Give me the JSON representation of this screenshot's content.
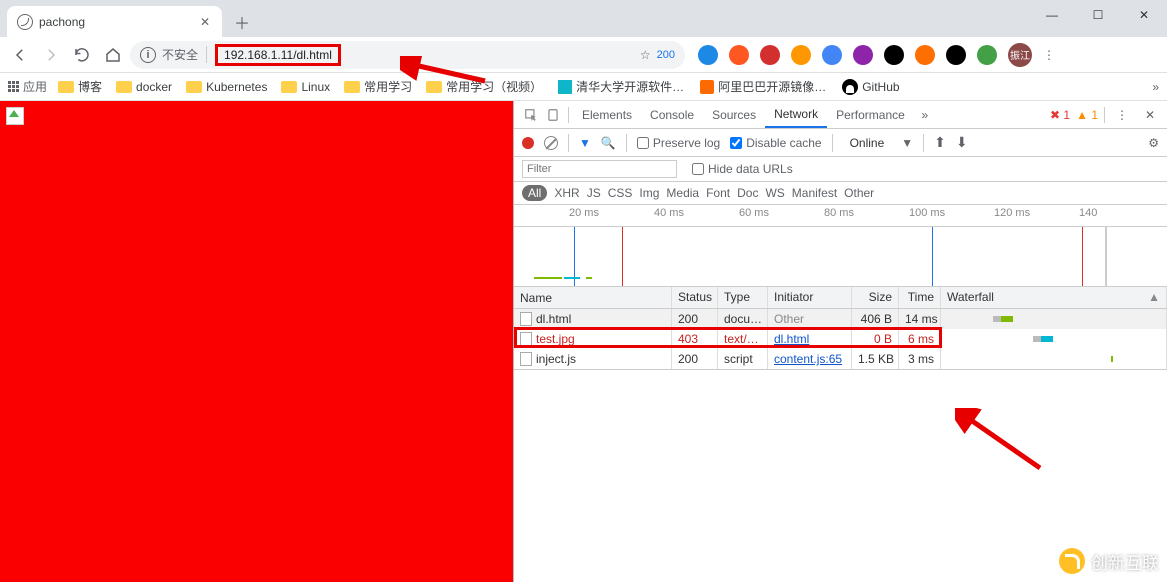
{
  "browser": {
    "tab_title": "pachong",
    "new_tab": "＋",
    "win": {
      "min": "—",
      "max": "☐",
      "close": "✕"
    },
    "address": {
      "security_text": "不安全",
      "url": "192.168.1.11/dl.html",
      "star": "☆",
      "pill": "200"
    },
    "ext_colors": [
      "#1e88e5",
      "#ff5722",
      "#d32f2f",
      "#ff9800",
      "#4285f4",
      "#8e24aa",
      "#000000",
      "#ff6f00",
      "#000000",
      "#43a047"
    ],
    "avatar": "振江",
    "bookmarks": {
      "apps": "应用",
      "items": [
        "博客",
        "docker",
        "Kubernetes",
        "Linux",
        "常用学习",
        "常用学习（视频）"
      ],
      "tsinghua": "清华大学开源软件…",
      "aliyun": "阿里巴巴开源镜像…",
      "github": "GitHub"
    }
  },
  "devtools": {
    "tabs": [
      "Elements",
      "Console",
      "Sources",
      "Network",
      "Performance"
    ],
    "active_tab": "Network",
    "err_count": "1",
    "warn_count": "1",
    "toolbar": {
      "preserve": "Preserve log",
      "disable_cache": "Disable cache",
      "online": "Online"
    },
    "filter_placeholder": "Filter",
    "hide_urls": "Hide data URLs",
    "ftypes": [
      "All",
      "XHR",
      "JS",
      "CSS",
      "Img",
      "Media",
      "Font",
      "Doc",
      "WS",
      "Manifest",
      "Other"
    ],
    "timeline_ticks": [
      "20 ms",
      "40 ms",
      "60 ms",
      "80 ms",
      "100 ms",
      "120 ms",
      "140"
    ],
    "table": {
      "headers": [
        "Name",
        "Status",
        "Type",
        "Initiator",
        "Size",
        "Time",
        "Waterfall"
      ],
      "rows": [
        {
          "name": "dl.html",
          "status": "200",
          "type": "docu…",
          "init": "Other",
          "init_c": "#888",
          "size": "406 B",
          "time": "14 ms",
          "wf": {
            "l": 60,
            "w": 12,
            "c": "#7fba00",
            "pre": "#bbb"
          }
        },
        {
          "name": "test.jpg",
          "status": "403",
          "type": "text/…",
          "init": "dl.html",
          "init_c": "#1155cc",
          "size": "0 B",
          "time": "6 ms",
          "red": true,
          "wf": {
            "l": 100,
            "w": 12,
            "c": "#00b8d4",
            "pre": "#bbb"
          }
        },
        {
          "name": "inject.js",
          "status": "200",
          "type": "script",
          "init": "content.js:65",
          "init_c": "#1155cc",
          "size": "1.5 KB",
          "time": "3 ms",
          "wf": {
            "l": 170,
            "w": 2,
            "c": "#7fba00",
            "pre": ""
          }
        }
      ]
    }
  },
  "watermark": "创新互联"
}
